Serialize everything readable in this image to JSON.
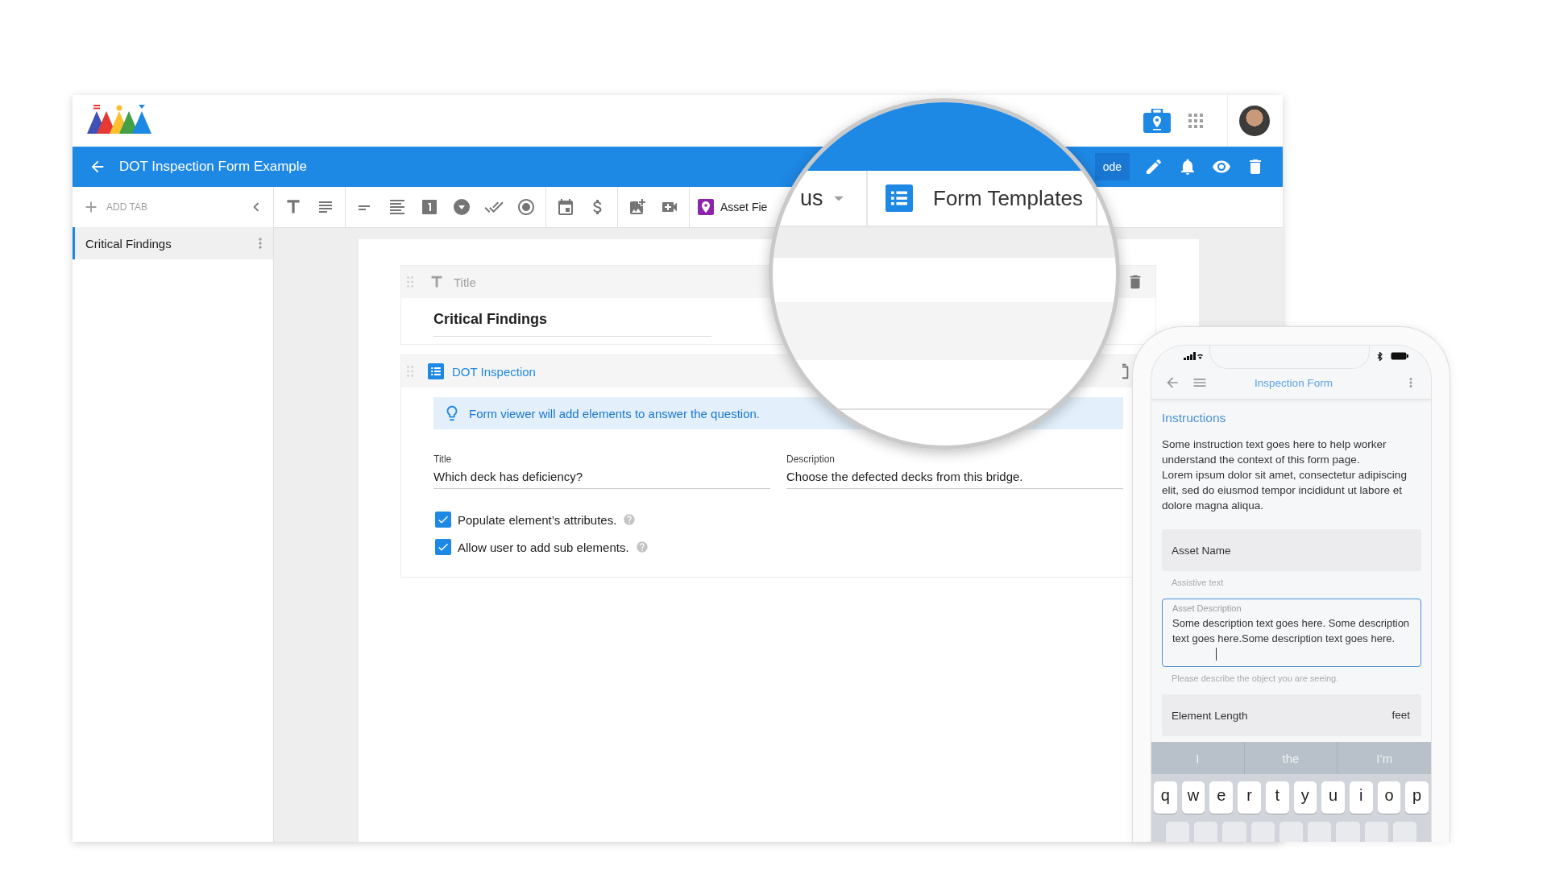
{
  "app": {
    "title": "DOT Inspection Form Example",
    "mode_button": "ode"
  },
  "sidebar": {
    "add_tab": "ADD TAB",
    "tabs": [
      {
        "label": "Critical Findings",
        "selected": true
      }
    ]
  },
  "toolbar": {
    "asset_fields": "Asset Fie"
  },
  "lens": {
    "partial_label": "us",
    "tab": "Form Templates"
  },
  "form": {
    "title_element": {
      "header": "Title",
      "value": "Critical Findings"
    },
    "question": {
      "header": "DOT Inspection",
      "hint": "Form viewer will add elements to answer the question.",
      "fields": [
        {
          "label": "Title",
          "value": "Which deck has deficiency?"
        },
        {
          "label": "Description",
          "value": "Choose the defected decks from this bridge."
        }
      ],
      "options": [
        {
          "label": "Populate element’s attributes.",
          "checked": true
        },
        {
          "label": "Allow user to add sub elements.",
          "checked": true
        }
      ]
    }
  },
  "phone": {
    "title": "Inspection Form",
    "heading": "Instructions",
    "instructions": [
      "Some instruction text goes here to help worker understand the context of this form page.",
      "Lorem ipsum dolor sit amet, consectetur adipiscing elit, sed do eiusmod tempor incididunt ut labore et dolore magna aliqua."
    ],
    "fields": [
      {
        "kind": "filled",
        "placeholder": "Asset Name",
        "helper": "Assistive text"
      },
      {
        "kind": "outlined",
        "label": "Asset Description",
        "value": "Some description text goes here. Some description text goes here.Some description text goes here.",
        "helper": "Please describe the object you are seeing."
      },
      {
        "kind": "unit",
        "placeholder": "Element Length",
        "suffix": "feet"
      }
    ],
    "suggestions": [
      "I",
      "the",
      "I’m"
    ],
    "keys": [
      "q",
      "w",
      "e",
      "r",
      "t",
      "y",
      "u",
      "i",
      "o",
      "p"
    ]
  }
}
